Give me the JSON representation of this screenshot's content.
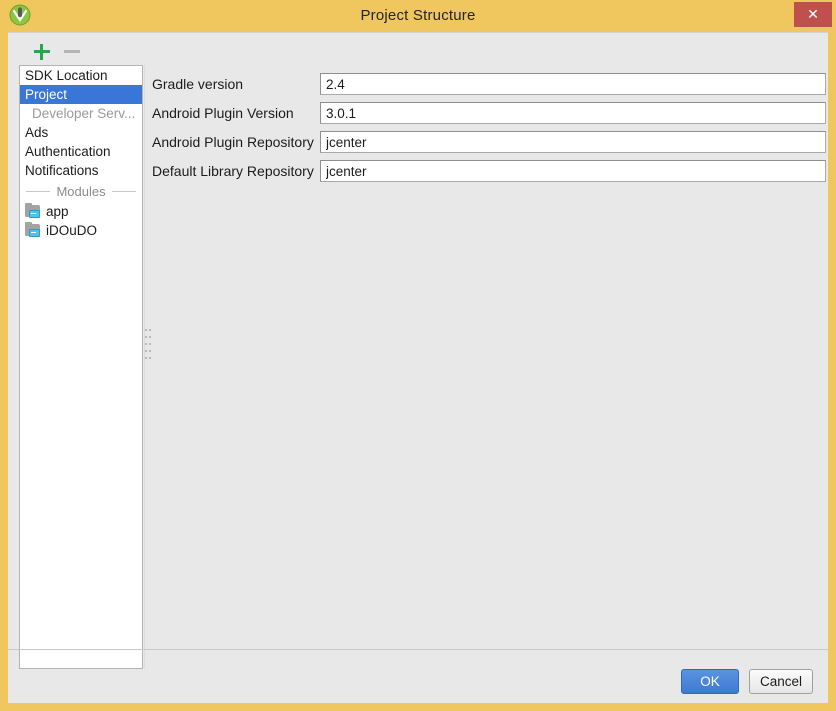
{
  "window": {
    "title": "Project Structure",
    "app_icon": "android-studio-icon",
    "close_label": "✕",
    "accent_titlebar": "#efc75e",
    "close_button_color": "#c0504d"
  },
  "toolbar": {
    "add_label": "+",
    "remove_label": "−"
  },
  "sidebar": {
    "items": [
      {
        "label": "SDK Location",
        "type": "item",
        "selected": false
      },
      {
        "label": "Project",
        "type": "item",
        "selected": true
      },
      {
        "label": "Developer Serv...",
        "type": "category",
        "selected": false
      },
      {
        "label": "Ads",
        "type": "item",
        "selected": false
      },
      {
        "label": "Authentication",
        "type": "item",
        "selected": false
      },
      {
        "label": "Notifications",
        "type": "item",
        "selected": false
      },
      {
        "label": "Modules",
        "type": "separator",
        "selected": false
      },
      {
        "label": "app",
        "type": "module",
        "selected": false
      },
      {
        "label": "iDOuDO",
        "type": "module",
        "selected": false
      }
    ],
    "selected_color": "#3a76d8"
  },
  "form": {
    "rows": [
      {
        "label": "Gradle version",
        "value": "2.4"
      },
      {
        "label": "Android Plugin Version",
        "value": "3.0.1"
      },
      {
        "label": "Android Plugin Repository",
        "value": "jcenter"
      },
      {
        "label": "Default Library Repository",
        "value": "jcenter"
      }
    ]
  },
  "buttons": {
    "ok": "OK",
    "cancel": "Cancel"
  }
}
